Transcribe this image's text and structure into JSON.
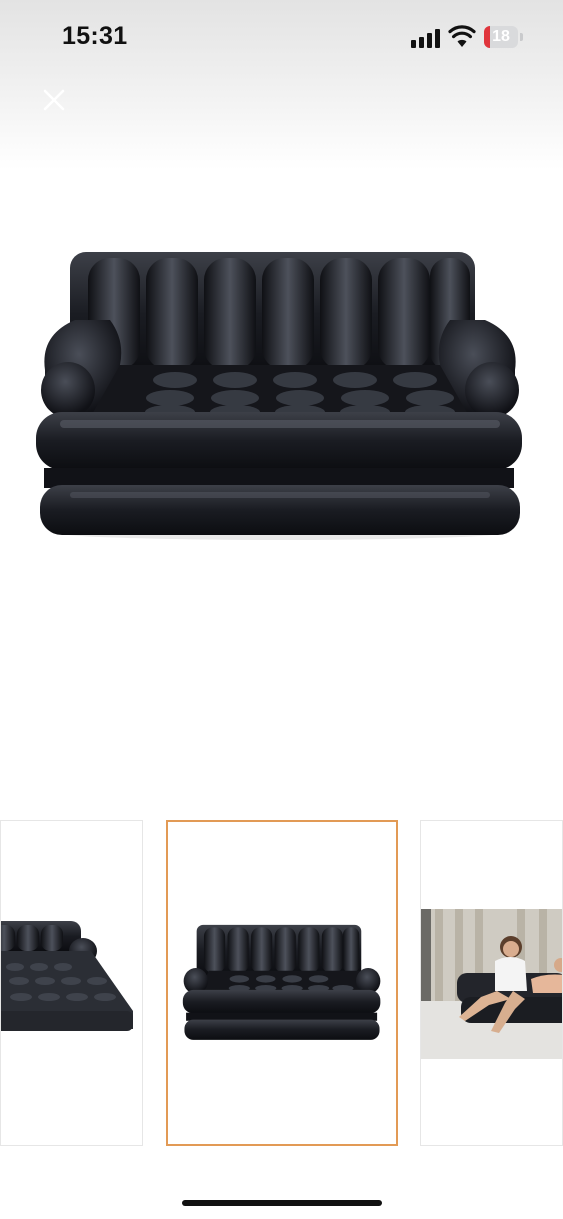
{
  "status_bar": {
    "time": "15:31",
    "battery_level": "18",
    "battery_color": "#e0353c",
    "icons": [
      "cellular-signal-icon",
      "wifi-icon",
      "battery-icon"
    ]
  },
  "header": {
    "close_icon": "close-icon"
  },
  "gallery": {
    "main_image": "inflatable-sofa-front-view",
    "selected_index": 1,
    "selected_border_color": "#e29a55",
    "thumbnails": [
      {
        "image": "inflatable-sofa-bed-unfolded"
      },
      {
        "image": "inflatable-sofa-front-view"
      },
      {
        "image": "people-sitting-on-inflatable-sofa"
      }
    ]
  }
}
